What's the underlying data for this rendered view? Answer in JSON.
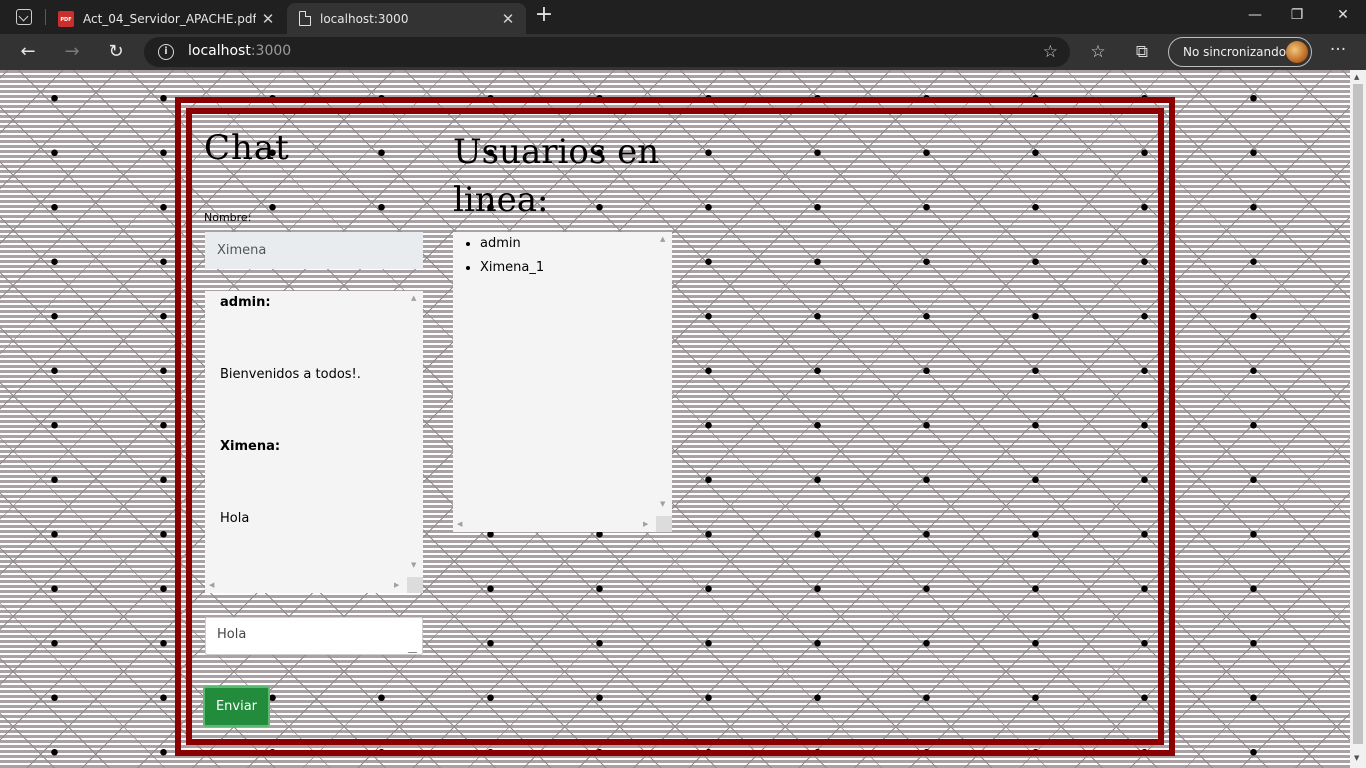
{
  "browser": {
    "tabs": [
      {
        "title": "Act_04_Servidor_APACHE.pdf",
        "icon": "pdf-icon",
        "icon_text": "PDF",
        "active": false
      },
      {
        "title": "localhost:3000",
        "icon": "document-icon",
        "active": true
      }
    ],
    "tab_close": "✕",
    "new_tab": "+",
    "window_controls": {
      "minimize": "—",
      "restore": "❐",
      "close": "✕"
    },
    "nav": {
      "back": "←",
      "forward": "→",
      "reload": "↻"
    },
    "address": {
      "host": "localhost",
      "port": ":3000",
      "info_glyph": "i"
    },
    "icons": {
      "add_favorite": "☆",
      "favorites": "☆",
      "collections": "⧉",
      "more": "···"
    },
    "sync_label": "No sincronizando"
  },
  "page": {
    "colors": {
      "frame": "#8b0000",
      "button": "#228b3c",
      "pattern_stripe": "#a9a1a4"
    },
    "chat_heading": "Chat",
    "users_heading": "Usuarios en linea:",
    "name_label": "Nombre:",
    "name_value": "Ximena",
    "messages": [
      {
        "user": "admin:",
        "text": "Bienvenidos a todos!."
      },
      {
        "user": "Ximena:",
        "text": "Hola"
      }
    ],
    "online_users": [
      "admin",
      "Ximena_1"
    ],
    "message_value": "Hola",
    "send_label": "Enviar"
  }
}
